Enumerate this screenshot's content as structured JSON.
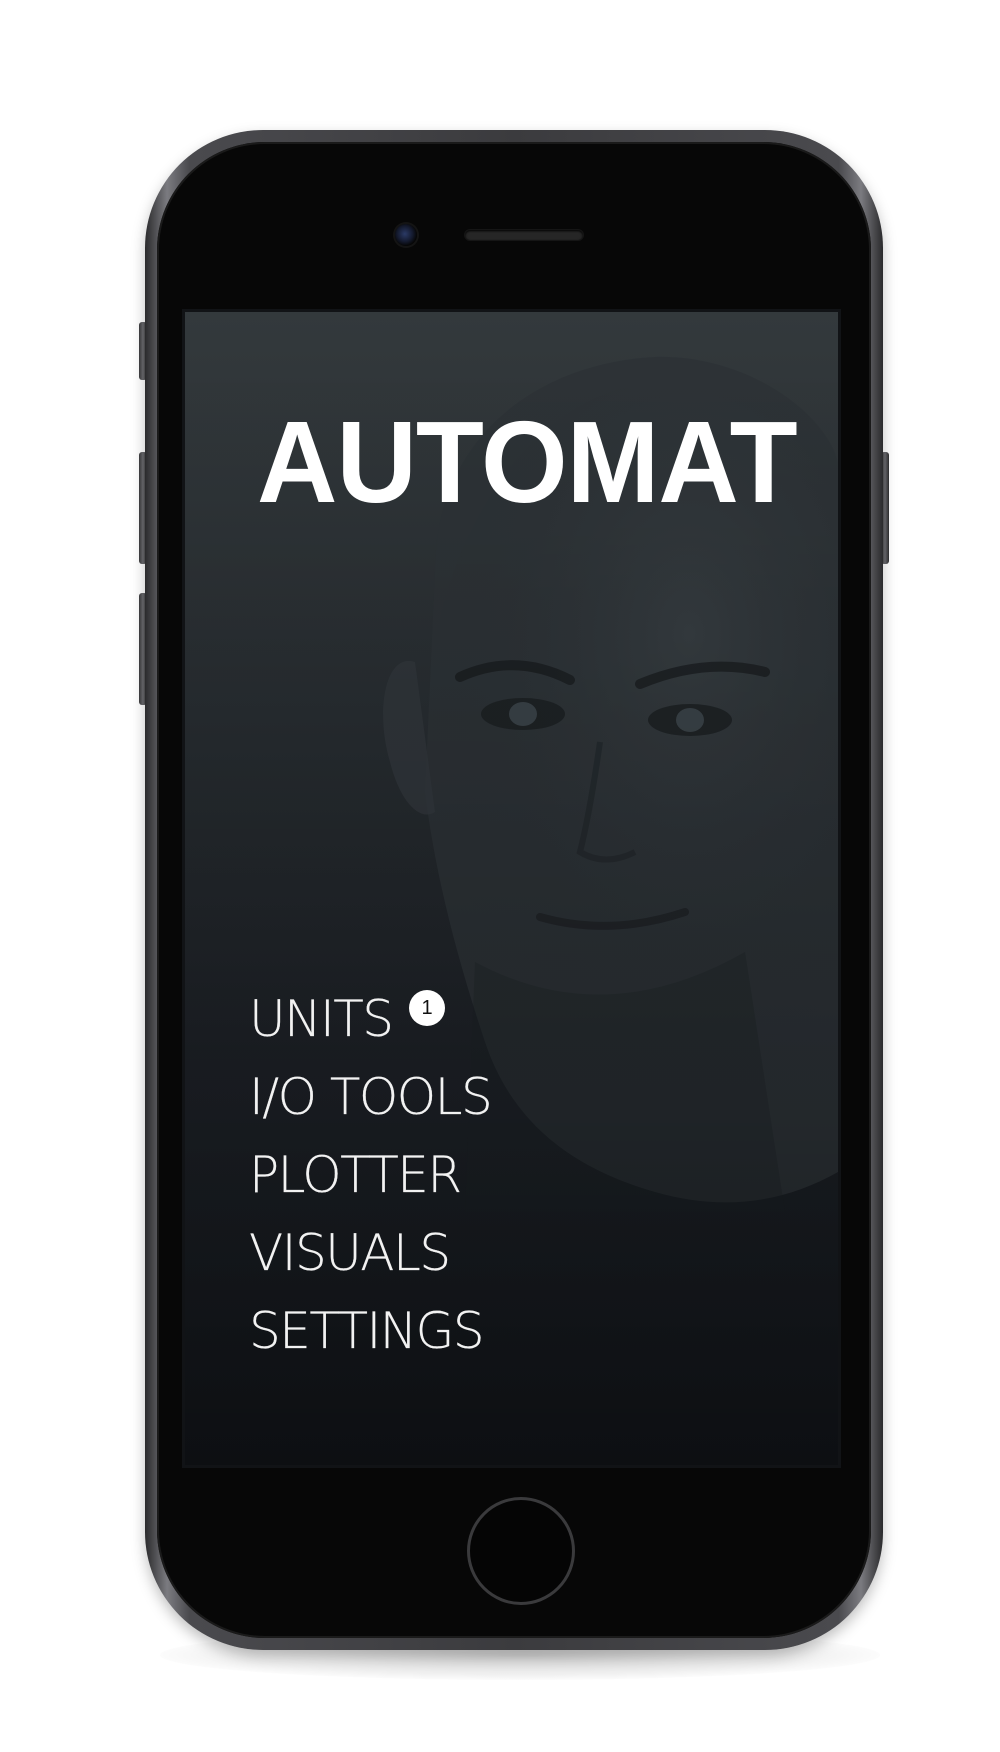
{
  "app": {
    "title": "AUTOMAT"
  },
  "menu": {
    "items": [
      {
        "label": "UNITS",
        "badge": "1"
      },
      {
        "label": "I/O TOOLS"
      },
      {
        "label": "PLOTTER"
      },
      {
        "label": "VISUALS"
      },
      {
        "label": "SETTINGS"
      }
    ]
  },
  "colors": {
    "background_top": "#33393c",
    "background_bottom": "#14171c",
    "text": "#ffffff",
    "badge_bg": "#ffffff",
    "phone_frame": "#3b3b3e"
  },
  "icons": {
    "camera": "front-camera-icon",
    "speaker": "earpiece-speaker-icon",
    "home": "home-button-icon"
  }
}
